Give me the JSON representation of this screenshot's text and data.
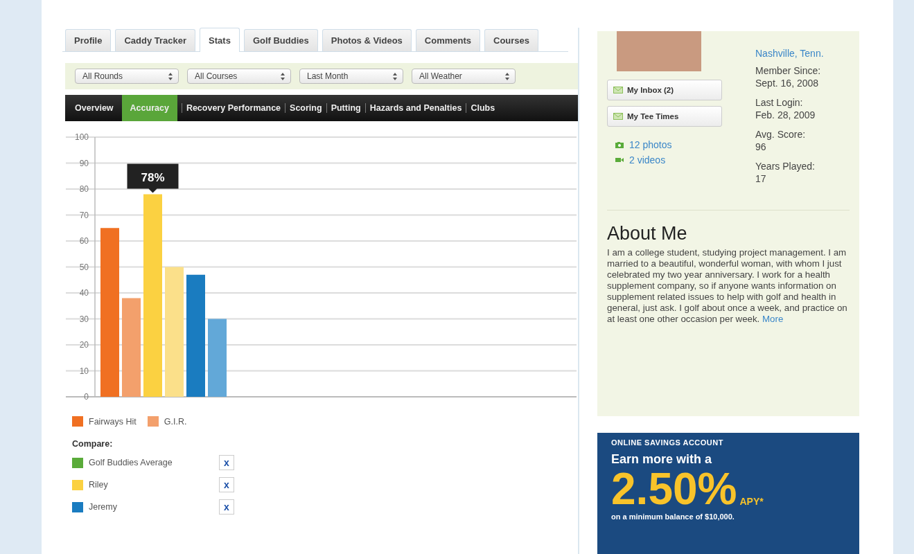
{
  "tabs": [
    {
      "label": "Profile",
      "selected": false
    },
    {
      "label": "Caddy Tracker",
      "selected": false
    },
    {
      "label": "Stats",
      "selected": true
    },
    {
      "label": "Golf Buddies",
      "selected": false
    },
    {
      "label": "Photos & Videos",
      "selected": false
    },
    {
      "label": "Comments",
      "selected": false
    },
    {
      "label": "Courses",
      "selected": false
    }
  ],
  "filters": [
    {
      "value": "All Rounds"
    },
    {
      "value": "All Courses"
    },
    {
      "value": "Last Month"
    },
    {
      "value": "All Weather"
    }
  ],
  "subnav": [
    {
      "label": "Overview",
      "selected": false
    },
    {
      "label": "Accuracy",
      "selected": true
    },
    {
      "label": "Recovery Performance",
      "selected": false
    },
    {
      "label": "Scoring",
      "selected": false
    },
    {
      "label": "Putting",
      "selected": false
    },
    {
      "label": "Hazards and Penalties",
      "selected": false
    },
    {
      "label": "Clubs",
      "selected": false
    }
  ],
  "chart_data": {
    "type": "bar",
    "ylim": [
      0,
      100
    ],
    "yticks": [
      0,
      10,
      20,
      30,
      40,
      50,
      60,
      70,
      80,
      90,
      100
    ],
    "stacked": true,
    "grid": true,
    "series": [
      {
        "name": "Fairways Hit",
        "color": "#f07022",
        "values": [
          65,
          null,
          null,
          null,
          null,
          null
        ]
      },
      {
        "name": "G.I.R.",
        "color": "#f3a06c",
        "values": [
          null,
          38,
          null,
          null,
          null,
          null
        ]
      },
      {
        "color": "#fbd141",
        "values": [
          null,
          null,
          78,
          null,
          null,
          null
        ]
      },
      {
        "color": "#fbe08a",
        "values": [
          null,
          null,
          null,
          50,
          null,
          null
        ]
      },
      {
        "color": "#1a7cc0",
        "values": [
          null,
          null,
          null,
          null,
          47,
          null
        ]
      },
      {
        "color": "#62a8d8",
        "values": [
          null,
          null,
          null,
          null,
          null,
          30
        ]
      }
    ],
    "annotations": [
      {
        "text": "78%"
      }
    ]
  },
  "compare": {
    "title": "Compare:",
    "items": [
      {
        "name": "Golf Buddies Average",
        "color": "#5aab3a",
        "remove": "x"
      },
      {
        "name": "Riley",
        "color": "#fbd141",
        "remove": "x"
      },
      {
        "name": "Jeremy",
        "color": "#1a7cc0",
        "remove": "x"
      }
    ]
  },
  "profile": {
    "buttons": [
      "My Inbox (2)",
      "My Tee Times"
    ],
    "media_links": [
      {
        "kind": "photos",
        "label": "12 photos"
      },
      {
        "kind": "videos",
        "label": "2 videos"
      }
    ],
    "location": "Nashville, Tenn.",
    "facts": [
      {
        "label": "Member Since:",
        "value": "Sept. 16, 2008"
      },
      {
        "label": "Last Login:",
        "value": "Feb. 28, 2009"
      },
      {
        "label": "Avg. Score:",
        "value": "96"
      },
      {
        "label": "Years Played:",
        "value": "17"
      }
    ]
  },
  "about": {
    "heading": "About Me",
    "text": "I am a college student, studying project management. I am married to a beautiful, wonderful woman, with whom I just celebrated my two year anniversary. I work for a health supplement company, so if anyone wants information on supplement related issues to help with golf and health in general, just ask. I golf about once a week, and practice on at least one other occasion per week.",
    "more": "More"
  },
  "ad": {
    "eyebrow": "ONLINE SAVINGS ACCOUNT",
    "headline": "Earn more with a",
    "rate": "2.50%",
    "rate_suffix": "APY*",
    "note": "on a minimum balance of $10,000."
  }
}
